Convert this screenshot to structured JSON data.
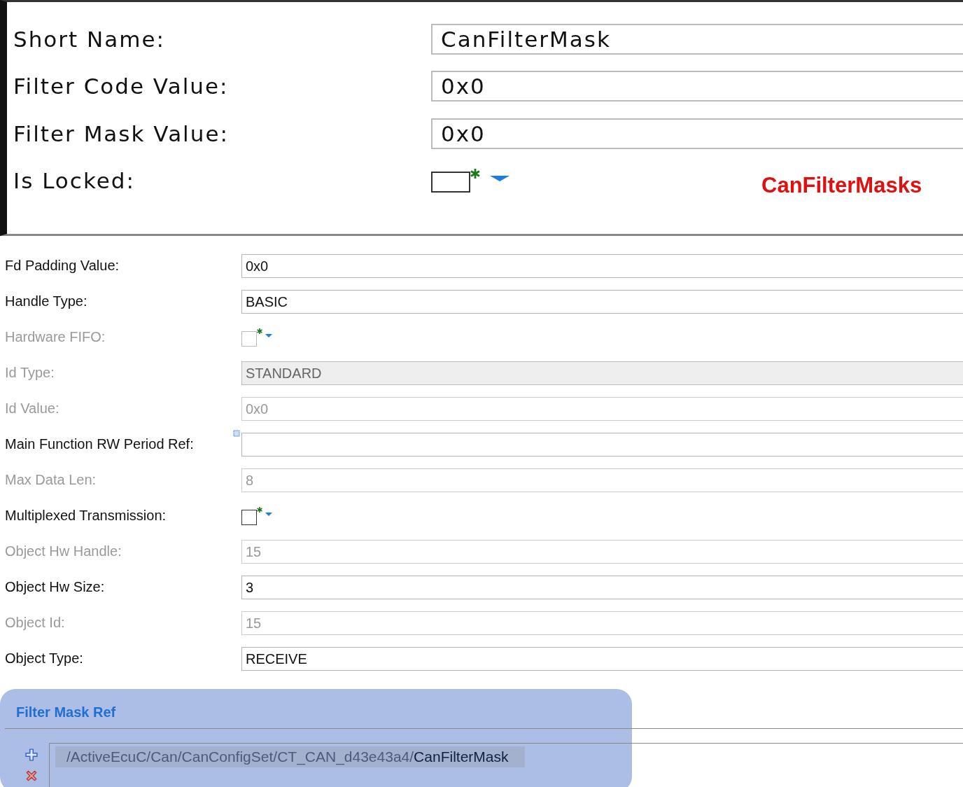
{
  "header_panel": {
    "rows": [
      {
        "kind": "text",
        "label": "Short Name:",
        "value": "CanFilterMask"
      },
      {
        "kind": "text",
        "label": "Filter Code Value:",
        "value": "0x0"
      },
      {
        "kind": "text",
        "label": "Filter Mask Value:",
        "value": "0x0"
      },
      {
        "kind": "checkbox",
        "label": "Is Locked:",
        "checked": false
      }
    ],
    "annotation": "CanFilterMasks"
  },
  "properties": [
    {
      "kind": "text",
      "label": "Fd Padding Value:",
      "value": "0x0",
      "disabled": false
    },
    {
      "kind": "text",
      "label": "Handle Type:",
      "value": "BASIC",
      "disabled": false
    },
    {
      "kind": "checkbox",
      "label": "Hardware FIFO:",
      "checked": false,
      "disabled": true
    },
    {
      "kind": "combo",
      "label": "Id Type:",
      "value": "STANDARD",
      "disabled": true
    },
    {
      "kind": "text",
      "label": "Id Value:",
      "value": "0x0",
      "disabled": true
    },
    {
      "kind": "reference",
      "label": "Main Function RW Period Ref:",
      "disabled": false
    },
    {
      "kind": "text",
      "label": "Max Data Len:",
      "value": "8",
      "disabled": true
    },
    {
      "kind": "checkbox",
      "label": "Multiplexed Transmission:",
      "checked": false,
      "disabled": false
    },
    {
      "kind": "text",
      "label": "Object Hw Handle:",
      "value": "15",
      "disabled": true
    },
    {
      "kind": "text",
      "label": "Object Hw Size:",
      "value": "3",
      "disabled": false
    },
    {
      "kind": "text",
      "label": "Object Id:",
      "value": "15",
      "disabled": true
    },
    {
      "kind": "text",
      "label": "Object Type:",
      "value": "RECEIVE",
      "disabled": false
    }
  ],
  "filter_mask_ref": {
    "title": "Filter Mask Ref",
    "items": [
      {
        "path": "/ActiveEcuC/Can/CanConfigSet/CT_CAN_d43e43a4/",
        "name": "CanFilterMask",
        "selected": true
      }
    ]
  }
}
